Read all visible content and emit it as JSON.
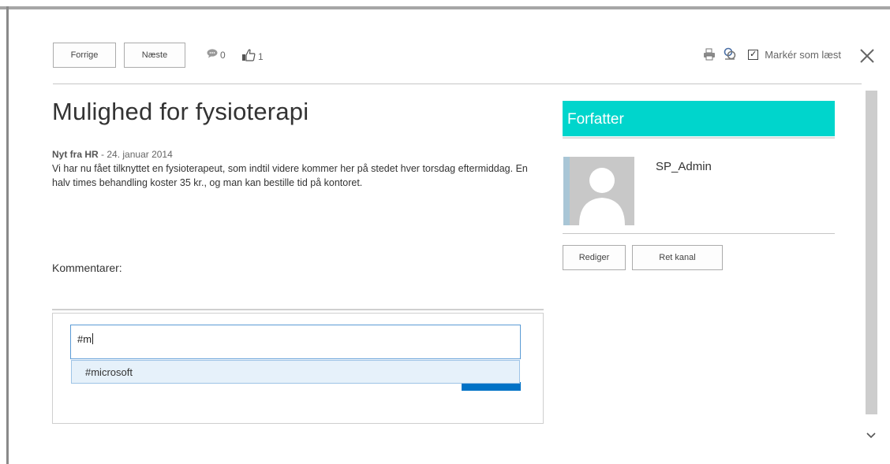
{
  "toolbar": {
    "prev_label": "Forrige",
    "next_label": "Næste",
    "comment_count": "0",
    "like_count": "1",
    "mark_read_label": "Markér som læst",
    "mark_read_checked": true,
    "icons": [
      "comment-icon",
      "like-icon",
      "print-icon",
      "link-icon",
      "checkbox-icon",
      "close-icon"
    ]
  },
  "post": {
    "title": "Mulighed for fysioterapi",
    "source": "Nyt fra HR",
    "date_sep": " - ",
    "date": "24. januar 2014",
    "body": "Vi har nu fået tilknyttet en fysioterapeut, som indtil videre kommer her på stedet hver torsdag eftermiddag. En halv times behandling koster 35 kr., og man kan bestille tid på kontoret."
  },
  "comments": {
    "heading": "Kommentarer:",
    "input_value": "#m",
    "suggestion": "#microsoft"
  },
  "author": {
    "header": "Forfatter",
    "name": "SP_Admin",
    "edit_label": "Rediger",
    "channel_label": "Ret kanal"
  },
  "colors": {
    "accent": "#00d5cc",
    "input_border": "#5b9bd5",
    "primary_button": "#0072c6",
    "suggestion_bg": "#e6f1fa"
  }
}
